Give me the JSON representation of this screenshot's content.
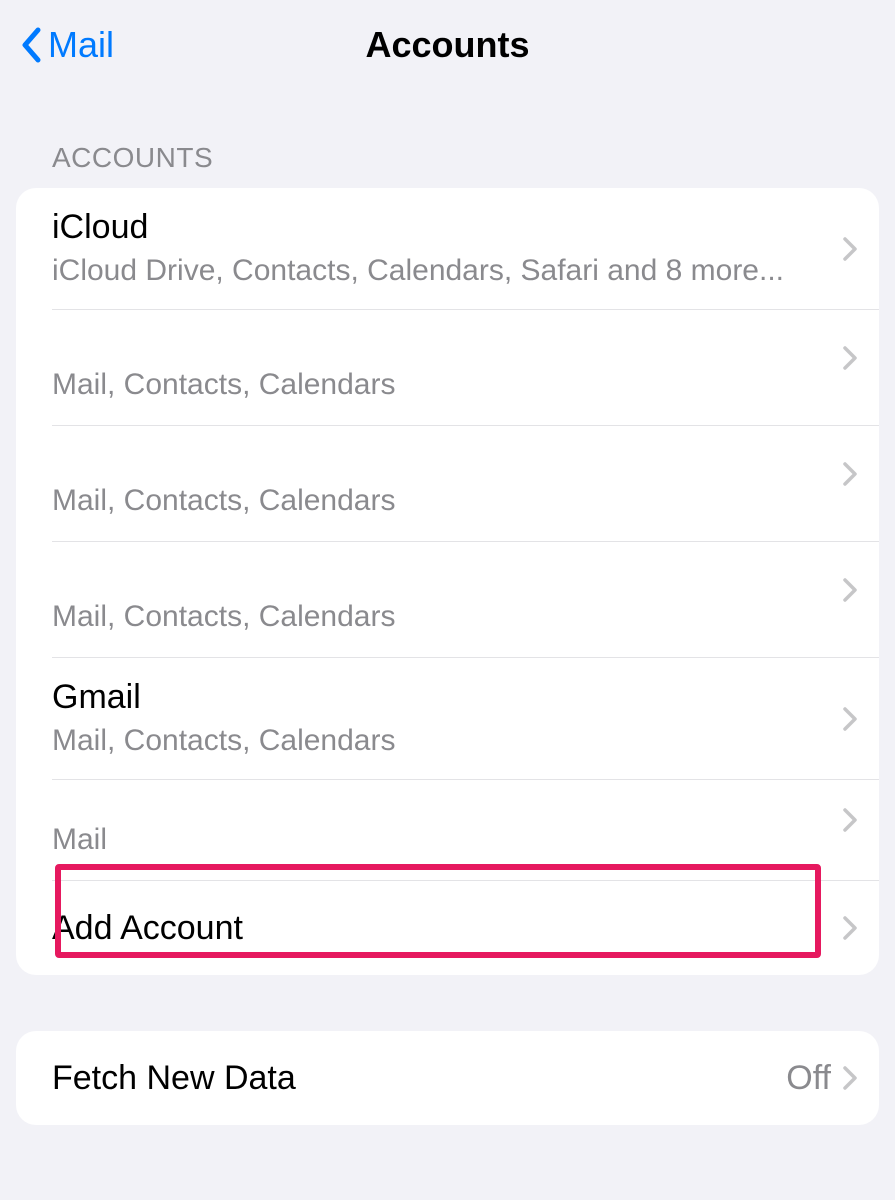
{
  "navbar": {
    "back_label": "Mail",
    "title": "Accounts"
  },
  "accounts_section": {
    "header": "ACCOUNTS",
    "items": [
      {
        "title": "iCloud",
        "subtitle": "iCloud Drive, Contacts, Calendars, Safari and 8 more..."
      },
      {
        "title": "",
        "subtitle": "Mail, Contacts, Calendars"
      },
      {
        "title": "",
        "subtitle": "Mail, Contacts, Calendars"
      },
      {
        "title": "",
        "subtitle": "Mail, Contacts, Calendars"
      },
      {
        "title": "Gmail",
        "subtitle": "Mail, Contacts, Calendars"
      },
      {
        "title": "",
        "subtitle": "Mail"
      }
    ],
    "add_account_label": "Add Account"
  },
  "fetch_section": {
    "label": "Fetch New Data",
    "value": "Off"
  }
}
